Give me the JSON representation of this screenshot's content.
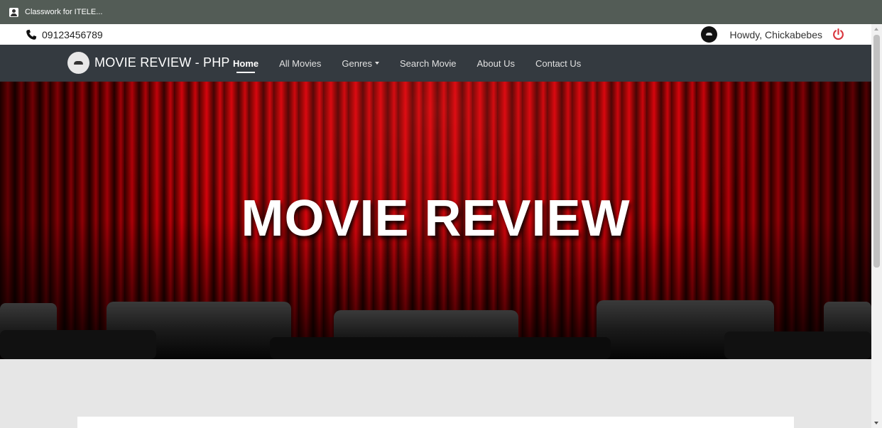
{
  "window": {
    "title": "Classwork for ITELE...",
    "icon": "person-icon"
  },
  "topbar": {
    "phone": "09123456789",
    "phone_icon": "phone-icon",
    "greeting": "Howdy, Chickabebes",
    "power_icon": "power-icon",
    "power_color": "#d9363e"
  },
  "navbar": {
    "brand": "MOVIE REVIEW - PHP",
    "background": "#343a40",
    "links": [
      {
        "label": "Home",
        "active": true
      },
      {
        "label": "All Movies"
      },
      {
        "label": "Genres",
        "dropdown": true
      },
      {
        "label": "Search Movie"
      },
      {
        "label": "About Us"
      },
      {
        "label": "Contact Us"
      }
    ]
  },
  "hero": {
    "title": "MOVIE REVIEW",
    "accent": "#c8000a"
  }
}
